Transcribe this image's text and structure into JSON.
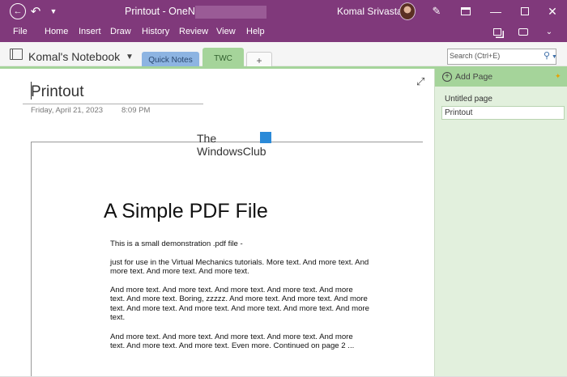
{
  "titlebar": {
    "app_title": "Printout  -  OneNote",
    "user_name": "Komal Srivastava"
  },
  "menu": {
    "items": [
      "File",
      "Home",
      "Insert",
      "Draw",
      "History",
      "Review",
      "View",
      "Help"
    ]
  },
  "notebook": {
    "name": "Komal's Notebook",
    "sections": [
      {
        "label": "Quick Notes",
        "color": "#8db4e2"
      },
      {
        "label": "TWC",
        "color": "#a5d49a",
        "active": true
      }
    ],
    "add_section_label": "+"
  },
  "search": {
    "placeholder": "Search (Ctrl+E)"
  },
  "page": {
    "title": "Printout",
    "date": "Friday, April 21, 2023",
    "time": "8:09 PM",
    "watermark_line1": "The",
    "watermark_line2": "WindowsClub"
  },
  "printout": {
    "heading": "A Simple PDF File",
    "paragraphs": [
      "This is a small demonstration .pdf file -",
      "just for use in the Virtual Mechanics tutorials. More text. And more text. And more text. And more text. And more text.",
      "And more text. And more text. And more text. And more text. And more text. And more text. Boring, zzzzz. And more text. And more text. And more text. And more text. And more text. And more text. And more text. And more text.",
      "And more text. And more text. And more text. And more text. And more text. And more text. And more text. Even more. Continued on page 2 ..."
    ]
  },
  "pages_pane": {
    "add_page_label": "Add Page",
    "pages": [
      "Untitled page",
      "Printout"
    ],
    "selected_index": 1
  },
  "colors": {
    "titlebar": "#80397b",
    "section_active": "#a5d49a",
    "pages_pane_bg": "#e2f0dd"
  }
}
